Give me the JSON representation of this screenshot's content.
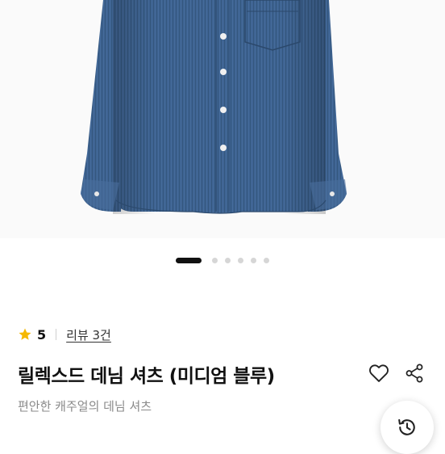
{
  "product": {
    "rating": "5",
    "review_link": "리뷰 3건",
    "title": "릴렉스드 데님 셔츠 (미디엄 블루)",
    "subtitle": "편안한 캐주얼의 데님 셔츠"
  },
  "carousel": {
    "total_images": 6,
    "active_index": 1
  },
  "icons": {
    "rating": "star-icon",
    "wishlist": "heart-icon",
    "share": "share-icon",
    "history": "history-icon"
  },
  "colors": {
    "star": "#F5B800",
    "denim": "#3A5F8F"
  }
}
